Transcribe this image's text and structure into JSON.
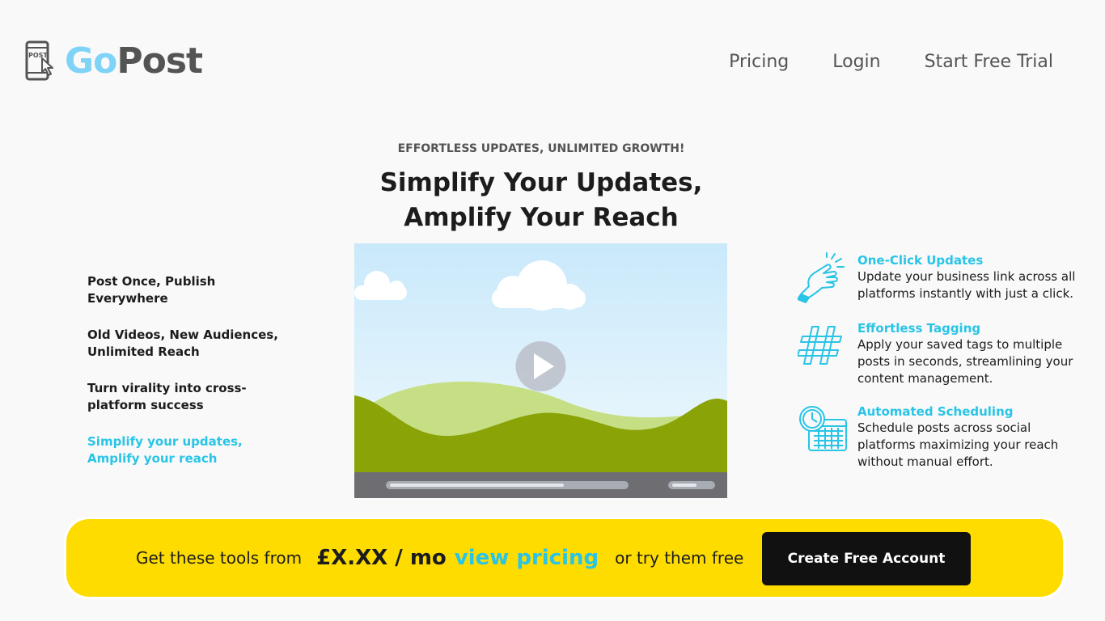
{
  "header": {
    "logo": {
      "go": "Go",
      "post": "Post",
      "icon_text": "POST"
    },
    "nav": [
      "Pricing",
      "Login",
      "Start Free Trial"
    ]
  },
  "hero": {
    "eyebrow": "EFFORTLESS UPDATES, UNLIMITED GROWTH!",
    "headline_line1": "Simplify Your Updates,",
    "headline_line2": "Amplify Your Reach"
  },
  "left_list": [
    "Post Once, Publish\nEverywhere",
    "Old Videos, New Audiences,\nUnlimited Reach",
    "Turn virality into cross-\nplatform success",
    "Simplify your updates,\nAmplify your reach"
  ],
  "video": {
    "progress": 0.74,
    "icon": "play-icon"
  },
  "features": [
    {
      "icon": "pointing-hand-icon",
      "title": "One-Click Updates",
      "desc": "Update your business link across all platforms instantly with just a click."
    },
    {
      "icon": "hashtag-icon",
      "title": "Effortless Tagging",
      "desc": "Apply your saved tags to multiple posts in seconds, streamlining your content management."
    },
    {
      "icon": "calendar-clock-icon",
      "title": "Automated Scheduling",
      "desc": "Schedule posts across social platforms maximizing your reach without manual effort."
    }
  ],
  "cta": {
    "from_text": "Get these tools from",
    "price": "£X.XX / mo",
    "link": "view pricing",
    "or_text": "or try them free",
    "button": "Create Free Account"
  },
  "colors": {
    "accent": "#29c4e6",
    "cta_bg": "#ffdc00",
    "button_bg": "#111111",
    "logo_go": "#7fd3f7",
    "logo_post": "#545454"
  }
}
